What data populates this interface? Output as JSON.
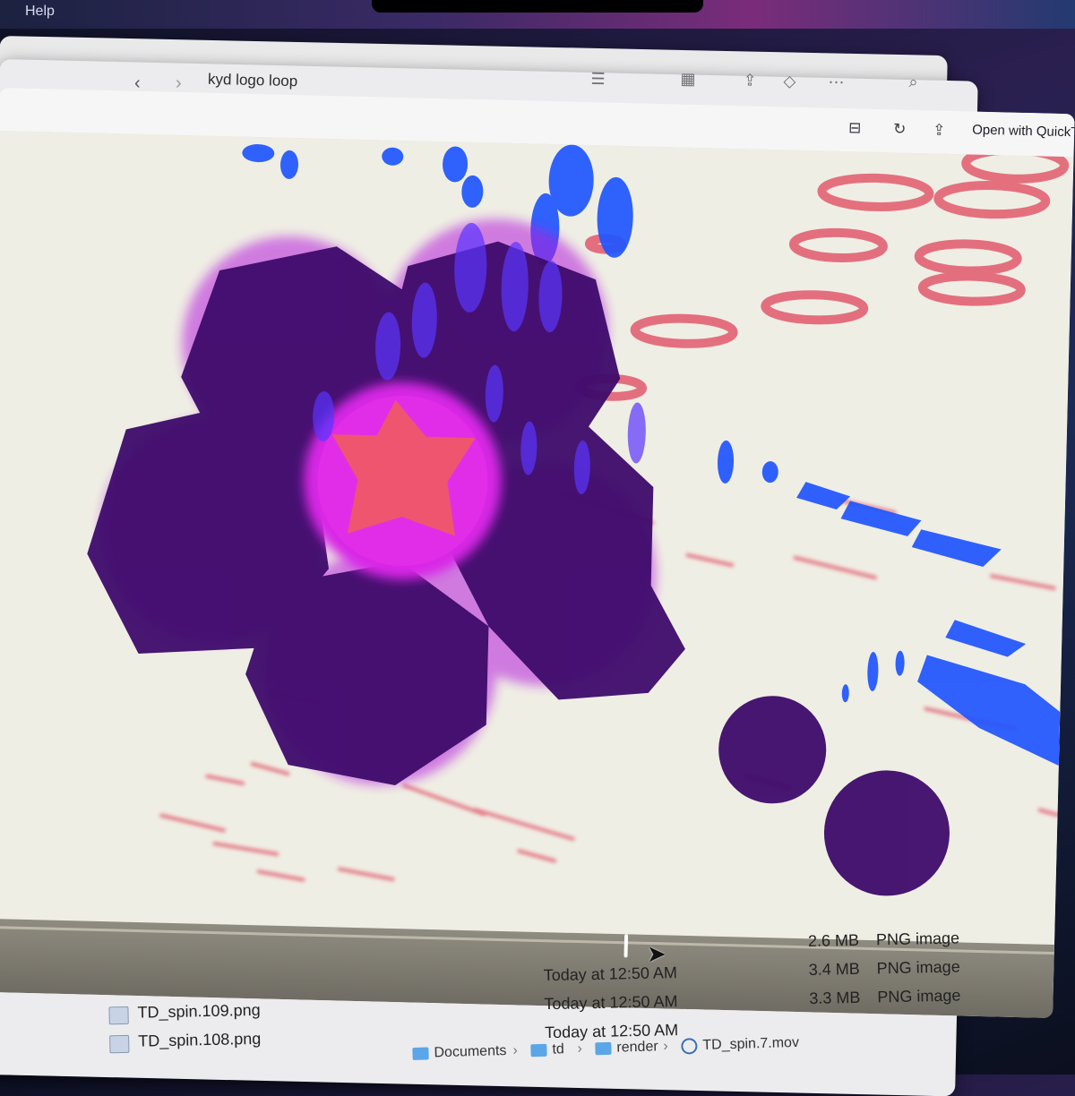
{
  "menubar": {
    "help_label": "Help"
  },
  "finder": {
    "window_title": "kyd logo loop",
    "files": [
      {
        "name": "",
        "date": "",
        "size": "2.6 MB",
        "kind": "PNG image"
      },
      {
        "name": "",
        "date": "Today at 12:50 AM",
        "size": "3.4 MB",
        "kind": "PNG image"
      },
      {
        "name": "TD_spin.109.png",
        "date": "Today at 12:50 AM",
        "size": "3.3 MB",
        "kind": "PNG image"
      },
      {
        "name": "TD_spin.108.png",
        "date": "Today at 12:50 AM",
        "size": "",
        "kind": ""
      }
    ],
    "path": [
      "Documents",
      "td",
      "render",
      "TD_spin.7.mov"
    ]
  },
  "quicklook": {
    "open_with_label": "Open with QuickT",
    "playback_progress": 0.6,
    "colors": {
      "petal": "#3e0b6b",
      "glow": "#d826e6",
      "center": "#f0556f",
      "blue_marks": "#1f55ff",
      "red_marks": "#e25a6d",
      "background": "#efeee4"
    }
  }
}
